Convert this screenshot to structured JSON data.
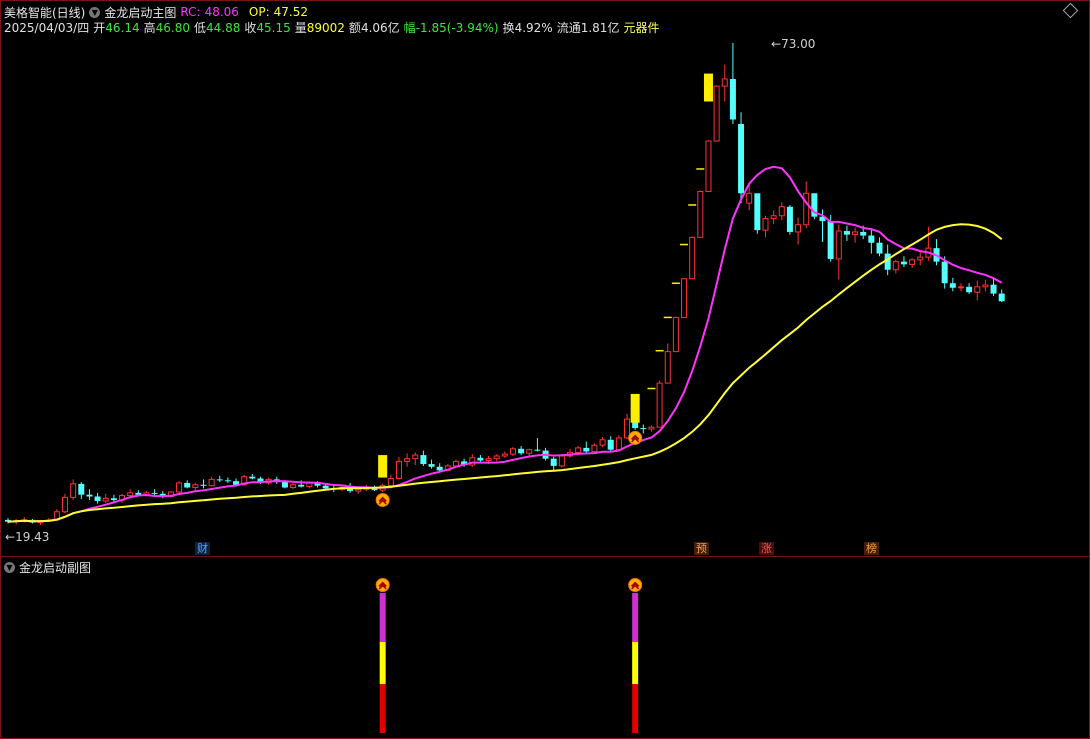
{
  "main_header": {
    "stock_name": "美格智能(日线)",
    "indicator_name": "金龙启动主图",
    "rc_label": "RC:",
    "rc_value": "48.06",
    "op_label": "OP:",
    "op_value": "47.52"
  },
  "quote": {
    "date": "2025/04/03/四",
    "open_label": "开",
    "open": "46.14",
    "high_label": "高",
    "high": "46.80",
    "low_label": "低",
    "low": "44.88",
    "close_label": "收",
    "close": "45.15",
    "volume_label": "量",
    "volume": "89002",
    "amount_label": "额",
    "amount": "4.06亿",
    "change_label": "幅",
    "change": "-1.85(-3.94%)",
    "turnover_label": "换",
    "turnover": "4.92%",
    "float_label": "流通",
    "float": "1.81亿",
    "sector": "元器件"
  },
  "price_labels": {
    "high": "73.00",
    "low": "19.43"
  },
  "event_markers": [
    {
      "label": "财",
      "color": "#4aa8ff"
    },
    {
      "label": "预",
      "color": "#ff9a3c"
    },
    {
      "label": "涨",
      "color": "#ff5050"
    },
    {
      "label": "榜",
      "color": "#ff9a3c"
    }
  ],
  "sub_header": {
    "indicator_name": "金龙启动副图"
  },
  "colors": {
    "up": "#ff3232",
    "down": "#54ffff",
    "ma_fast": "#ff33ff",
    "ma_slow": "#ffff33",
    "signal_bar": "#ffee00",
    "osc_top": "#d030d0",
    "osc_mid": "#ffff00",
    "osc_bot": "#e00000",
    "rc": "#ff33ff",
    "op": "#ffff33"
  },
  "chart_data": {
    "type": "candlestick",
    "price_range": [
      19.43,
      73.0
    ],
    "candles": [
      [
        20.0,
        20.2,
        19.6,
        19.8
      ],
      [
        19.8,
        20.1,
        19.5,
        19.9
      ],
      [
        19.9,
        20.3,
        19.7,
        20.0
      ],
      [
        20.0,
        20.1,
        19.6,
        19.7
      ],
      [
        19.7,
        20.0,
        19.43,
        19.9
      ],
      [
        19.9,
        20.2,
        19.8,
        20.0
      ],
      [
        20.0,
        21.2,
        19.9,
        20.9
      ],
      [
        20.9,
        22.9,
        20.7,
        22.5
      ],
      [
        22.5,
        24.5,
        22.2,
        24.0
      ],
      [
        24.0,
        24.2,
        22.3,
        22.8
      ],
      [
        22.8,
        23.4,
        22.2,
        22.6
      ],
      [
        22.6,
        23.0,
        21.8,
        22.1
      ],
      [
        22.1,
        22.9,
        21.9,
        22.4
      ],
      [
        22.4,
        22.8,
        22.0,
        22.2
      ],
      [
        22.2,
        22.9,
        21.9,
        22.7
      ],
      [
        22.7,
        23.4,
        22.4,
        23.0
      ],
      [
        23.0,
        23.3,
        22.6,
        22.8
      ],
      [
        22.8,
        23.2,
        22.6,
        23.0
      ],
      [
        23.0,
        23.4,
        22.7,
        22.9
      ],
      [
        22.9,
        23.2,
        22.4,
        22.6
      ],
      [
        22.6,
        23.2,
        22.5,
        23.1
      ],
      [
        23.1,
        24.3,
        23.0,
        24.1
      ],
      [
        24.1,
        24.4,
        23.5,
        23.6
      ],
      [
        23.6,
        24.1,
        23.3,
        23.9
      ],
      [
        23.9,
        24.5,
        23.5,
        23.8
      ],
      [
        23.8,
        24.8,
        23.7,
        24.5
      ],
      [
        24.5,
        24.9,
        24.2,
        24.4
      ],
      [
        24.4,
        24.7,
        24.1,
        24.3
      ],
      [
        24.3,
        24.6,
        23.8,
        23.9
      ],
      [
        23.9,
        25.0,
        23.8,
        24.8
      ],
      [
        24.8,
        25.1,
        24.5,
        24.6
      ],
      [
        24.6,
        24.8,
        24.0,
        24.1
      ],
      [
        24.1,
        24.7,
        23.9,
        24.5
      ],
      [
        24.5,
        24.8,
        24.0,
        24.2
      ],
      [
        24.2,
        24.4,
        23.5,
        23.6
      ],
      [
        23.6,
        24.2,
        23.4,
        23.9
      ],
      [
        23.9,
        24.4,
        23.6,
        23.7
      ],
      [
        23.7,
        24.3,
        23.5,
        24.1
      ],
      [
        24.1,
        24.3,
        23.6,
        23.8
      ],
      [
        23.8,
        24.1,
        23.4,
        23.5
      ],
      [
        23.5,
        23.9,
        23.1,
        23.4
      ],
      [
        23.4,
        23.8,
        23.2,
        23.6
      ],
      [
        23.6,
        24.1,
        23.0,
        23.2
      ],
      [
        23.2,
        23.6,
        22.9,
        23.4
      ],
      [
        23.4,
        23.9,
        23.2,
        23.6
      ],
      [
        23.6,
        23.8,
        23.2,
        23.3
      ],
      [
        23.3,
        24.0,
        23.1,
        23.8
      ],
      [
        23.8,
        25.0,
        23.6,
        24.6
      ],
      [
        24.6,
        27.0,
        24.5,
        26.5
      ],
      [
        26.5,
        27.4,
        25.9,
        26.8
      ],
      [
        26.8,
        27.5,
        26.1,
        27.2
      ],
      [
        27.2,
        27.7,
        26.0,
        26.2
      ],
      [
        26.2,
        26.7,
        25.7,
        25.9
      ],
      [
        25.9,
        26.3,
        25.3,
        25.5
      ],
      [
        25.5,
        26.2,
        25.4,
        26.0
      ],
      [
        26.0,
        26.7,
        25.8,
        26.5
      ],
      [
        26.5,
        26.8,
        25.9,
        26.1
      ],
      [
        26.1,
        27.3,
        25.9,
        26.9
      ],
      [
        26.9,
        27.2,
        26.4,
        26.6
      ],
      [
        26.6,
        27.1,
        26.2,
        26.8
      ],
      [
        26.8,
        27.3,
        26.5,
        27.1
      ],
      [
        27.1,
        27.6,
        26.9,
        27.3
      ],
      [
        27.3,
        28.1,
        27.1,
        27.9
      ],
      [
        27.9,
        28.2,
        27.2,
        27.4
      ],
      [
        27.4,
        27.9,
        27.1,
        27.8
      ],
      [
        27.8,
        29.1,
        27.6,
        27.7
      ],
      [
        27.7,
        28.0,
        26.6,
        26.8
      ],
      [
        26.8,
        27.0,
        25.4,
        26.0
      ],
      [
        26.0,
        27.3,
        25.8,
        27.1
      ],
      [
        27.1,
        27.9,
        26.9,
        27.5
      ],
      [
        27.5,
        28.2,
        27.2,
        28.0
      ],
      [
        28.0,
        28.7,
        27.4,
        27.6
      ],
      [
        27.6,
        28.5,
        27.4,
        28.3
      ],
      [
        28.3,
        29.2,
        28.1,
        28.9
      ],
      [
        28.9,
        29.3,
        27.5,
        27.8
      ],
      [
        27.8,
        29.4,
        27.6,
        29.1
      ],
      [
        29.1,
        31.8,
        29.0,
        31.2
      ],
      [
        31.2,
        31.9,
        30.0,
        30.2
      ],
      [
        30.2,
        30.6,
        29.6,
        30.1
      ],
      [
        30.1,
        30.5,
        29.8,
        30.3
      ],
      [
        30.3,
        35.5,
        30.3,
        35.2
      ],
      [
        35.2,
        39.6,
        35.2,
        38.7
      ],
      [
        38.7,
        42.6,
        38.7,
        42.5
      ],
      [
        42.5,
        46.9,
        42.5,
        46.8
      ],
      [
        46.8,
        51.5,
        46.8,
        51.4
      ],
      [
        51.4,
        56.6,
        51.4,
        56.5
      ],
      [
        56.5,
        62.2,
        56.5,
        62.1
      ],
      [
        62.1,
        68.3,
        62.1,
        68.2
      ],
      [
        68.2,
        70.6,
        66.5,
        69.0
      ],
      [
        69.0,
        73.0,
        64.0,
        64.5
      ],
      [
        64.0,
        65.3,
        55.2,
        56.3
      ],
      [
        55.2,
        57.3,
        54.4,
        56.3
      ],
      [
        56.3,
        55.5,
        51.8,
        52.2
      ],
      [
        52.2,
        53.8,
        51.4,
        53.5
      ],
      [
        53.5,
        54.4,
        52.9,
        53.8
      ],
      [
        53.8,
        55.3,
        53.3,
        54.8
      ],
      [
        54.8,
        55.0,
        51.7,
        52.0
      ],
      [
        52.0,
        53.6,
        50.6,
        52.8
      ],
      [
        52.8,
        57.6,
        52.4,
        56.3
      ],
      [
        56.3,
        56.3,
        53.4,
        53.7
      ],
      [
        53.7,
        54.5,
        50.9,
        53.2
      ],
      [
        53.2,
        53.9,
        48.7,
        49.0
      ],
      [
        49.0,
        52.8,
        46.7,
        52.1
      ],
      [
        52.1,
        52.7,
        51.0,
        51.7
      ],
      [
        51.7,
        52.5,
        50.8,
        52.0
      ],
      [
        52.0,
        52.7,
        51.2,
        51.6
      ],
      [
        51.6,
        52.3,
        49.6,
        50.8
      ],
      [
        50.8,
        51.4,
        49.3,
        49.6
      ],
      [
        49.6,
        50.6,
        47.2,
        47.8
      ],
      [
        47.8,
        48.9,
        47.4,
        48.7
      ],
      [
        48.7,
        49.3,
        48.1,
        48.4
      ],
      [
        48.4,
        49.1,
        48.0,
        48.9
      ],
      [
        48.9,
        49.8,
        48.3,
        49.2
      ],
      [
        49.2,
        52.6,
        48.8,
        50.2
      ],
      [
        50.2,
        51.2,
        48.3,
        48.7
      ],
      [
        48.7,
        49.3,
        45.7,
        46.3
      ],
      [
        46.3,
        46.9,
        45.4,
        45.8
      ],
      [
        45.8,
        46.3,
        45.4,
        45.9
      ],
      [
        45.9,
        46.3,
        45.1,
        45.3
      ],
      [
        45.3,
        46.6,
        44.4,
        45.9
      ],
      [
        45.9,
        46.7,
        45.4,
        46.1
      ],
      [
        46.14,
        46.8,
        44.88,
        45.15
      ],
      [
        45.15,
        45.6,
        44.2,
        44.3
      ]
    ],
    "signal_bars": [
      {
        "index": 46,
        "from": 24.7,
        "to": 27.2
      },
      {
        "index": 77,
        "from": 30.8,
        "to": 34.0
      },
      {
        "index": 86,
        "from": 66.5,
        "to": 69.6
      }
    ],
    "step_marks": [
      {
        "index": 79,
        "value": 34.6
      },
      {
        "index": 80,
        "value": 38.8
      },
      {
        "index": 81,
        "value": 42.5
      },
      {
        "index": 82,
        "value": 46.3
      },
      {
        "index": 83,
        "value": 50.6
      },
      {
        "index": 84,
        "value": 55.0
      },
      {
        "index": 85,
        "value": 59.0
      }
    ],
    "start_signals": [
      46,
      77
    ],
    "event_marker_index": [
      21,
      77,
      84,
      97
    ],
    "sub_chart": {
      "signals": [
        {
          "index": 46,
          "segments": [
            1.0,
            0.65,
            0.35
          ]
        },
        {
          "index": 77,
          "segments": [
            1.0,
            0.65,
            0.35
          ]
        }
      ]
    }
  }
}
